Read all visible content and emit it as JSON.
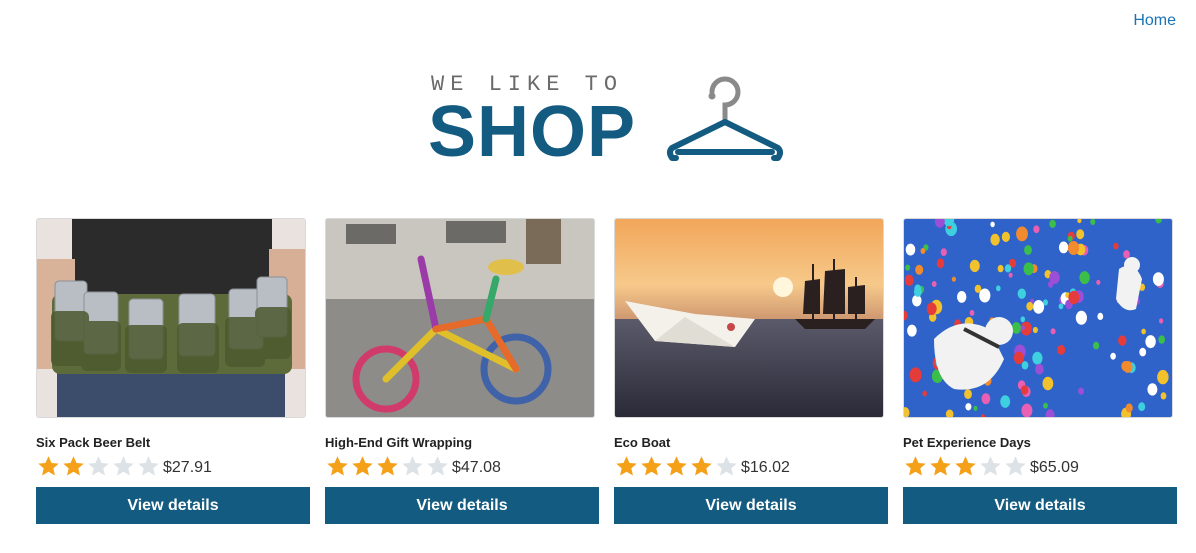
{
  "nav": {
    "home_label": "Home"
  },
  "logo": {
    "tagline": "WE LIKE TO",
    "word": "SHOP"
  },
  "colors": {
    "brand": "#135b80",
    "star_on": "#f4a019",
    "star_off": "#dde2e6",
    "link": "#1a73b5"
  },
  "products": [
    {
      "name": "Six Pack Beer Belt",
      "rating": 2,
      "max_rating": 5,
      "price": "$27.91",
      "button_label": "View details"
    },
    {
      "name": "High-End Gift Wrapping",
      "rating": 3,
      "max_rating": 5,
      "price": "$47.08",
      "button_label": "View details"
    },
    {
      "name": "Eco Boat",
      "rating": 4,
      "max_rating": 5,
      "price": "$16.02",
      "button_label": "View details"
    },
    {
      "name": "Pet Experience Days",
      "rating": 3,
      "max_rating": 5,
      "price": "$65.09",
      "button_label": "View details"
    }
  ]
}
